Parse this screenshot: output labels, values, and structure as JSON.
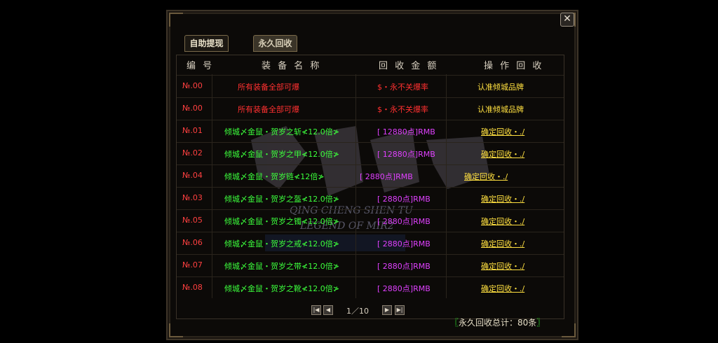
{
  "window": {
    "close_icon": "close-x-icon",
    "close_glyph": "✕"
  },
  "tabs": [
    {
      "label": "自助提现"
    },
    {
      "label": "永久回收"
    }
  ],
  "table": {
    "headers": [
      "编 号",
      "装 备 名 称",
      "回 收 金 额",
      "操 作 回 收"
    ],
    "rows": [
      {
        "no": "№.00",
        "name": "所有装备全部可爆",
        "amount": "$・永不关爆率",
        "action": "认准倾城品牌",
        "style": "notice"
      },
      {
        "no": "№.00",
        "name": "所有装备全部可爆",
        "amount": "$・永不关爆率",
        "action": "认准倾城品牌",
        "style": "notice"
      },
      {
        "no": "№.01",
        "name": "倾城〆金鼠・贺岁之斩≮12.0倍≯",
        "amount": "[ 12880点]RMB",
        "action": "确定回收・./",
        "style": "item"
      },
      {
        "no": "№.02",
        "name": "倾城〆金鼠・贺岁之甲≮12.0倍≯",
        "amount": "[ 12880点]RMB",
        "action": "确定回收・./",
        "style": "item"
      },
      {
        "no": "№.04",
        "name": "倾城〆金鼠・贺岁链≮12倍≯",
        "amount": "[  2880点]RMB",
        "action": "确定回收・./",
        "style": "item-offset"
      },
      {
        "no": "№.03",
        "name": "倾城〆金鼠・贺岁之盔≮12.0倍≯",
        "amount": "[  2880点]RMB",
        "action": "确定回收・./",
        "style": "item"
      },
      {
        "no": "№.05",
        "name": "倾城〆金鼠・贺岁之镯≮12.0倍≯",
        "amount": "[  2880点]RMB",
        "action": "确定回收・./",
        "style": "item"
      },
      {
        "no": "№.06",
        "name": "倾城〆金鼠・贺岁之戒≮12.0倍≯",
        "amount": "[  2880点]RMB",
        "action": "确定回收・./",
        "style": "item"
      },
      {
        "no": "№.07",
        "name": "倾城〆金鼠・贺岁之带≮12.0倍≯",
        "amount": "[  2880点]RMB",
        "action": "确定回收・./",
        "style": "item"
      },
      {
        "no": "№.08",
        "name": "倾城〆金鼠・贺岁之靴≮12.0倍≯",
        "amount": "[  2880点]RMB",
        "action": "确定回收・./",
        "style": "item"
      }
    ]
  },
  "watermark": {
    "line1": "QING CHENG SHEN TU",
    "line2": "LEGEND OF MIR2"
  },
  "pagination": {
    "page_text": "1／10",
    "first_glyph": "|◀",
    "prev_glyph": "◀",
    "next_glyph": "▶",
    "last_glyph": "▶|"
  },
  "footer": {
    "total_open": "〖",
    "total_text": "永久回收总计：80条",
    "total_close": "〗"
  }
}
